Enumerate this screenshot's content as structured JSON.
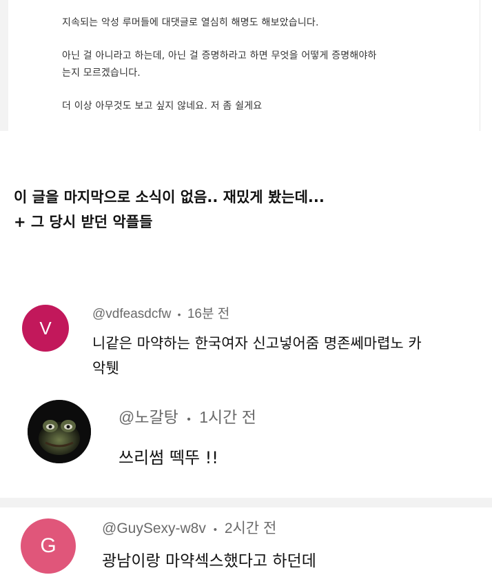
{
  "post": {
    "lines": [
      "지속되는 악성 루머들에 대댓글로 열심히 해명도 해보았습니다.",
      "아닌 걸 아니라고 하는데, 아닌 걸 증명하라고 하면 무엇을 어떻게 증명해야하",
      "는지 모르겠습니다.",
      "더 이상 아무것도 보고 싶지 않네요. 저 좀 쉴게요"
    ]
  },
  "caption": {
    "line1": "이 글을 마지막으로 소식이 없음.. 재밌게 봤는데...",
    "line2": "+ 그 당시 받던 악플들"
  },
  "comments": [
    {
      "avatar_letter": "V",
      "avatar_color": "#c2185b",
      "handle": "@vdfeasdcfw",
      "time": "16분 전",
      "text_line1": "니같은 마약하는 한국여자 신고넣어줌 명존쎄마렵노 카",
      "text_line2": "악퉷"
    },
    {
      "avatar_letter": "",
      "avatar_icon": "frog-avatar-icon",
      "handle": "@노갈탕",
      "time": "1시간 전",
      "text_line1": "쓰리썸 떽뚜 !!"
    },
    {
      "avatar_letter": "G",
      "avatar_color": "#e0567a",
      "handle": "@GuySexy-w8v",
      "time": "2시간 전",
      "text_line1": "광남이랑 마약섹스했다고 하던데"
    }
  ],
  "separator": "•"
}
